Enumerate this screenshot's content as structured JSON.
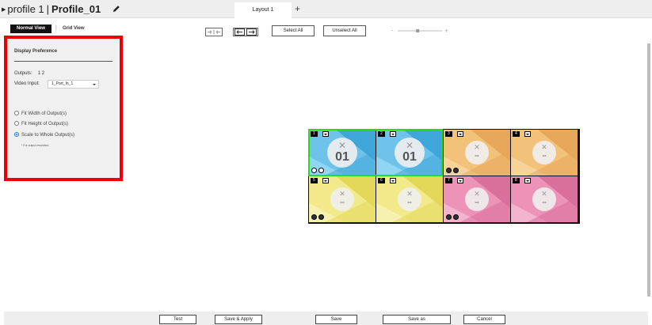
{
  "header": {
    "profile_label": "profile 1",
    "separator": "|",
    "profile_name": "Profile_01",
    "tabs": [
      {
        "label": "Layout 1"
      }
    ],
    "add_tab_label": "+"
  },
  "view_toggle": {
    "normal_label": "Normal View",
    "divider": "|",
    "grid_label": "Grid View",
    "active": "normal"
  },
  "toolbar": {
    "icons": [
      "collapse-arrows-icon",
      "expand-arrows-icon"
    ],
    "select_all_label": "Select All",
    "unselect_all_label": "Unselect All",
    "zoom_minus": "-",
    "zoom_plus": "+",
    "zoom_level": 0.45
  },
  "display_preference": {
    "heading": "Display Preference",
    "outputs_label": "Outputs:",
    "outputs_value": "1 2",
    "video_input_label": "Video Input:",
    "video_input_value": "1_Port_In_1",
    "options": [
      {
        "label": "Fit Width of Output(s)",
        "selected": false
      },
      {
        "label": "Fit Height of Output(s)",
        "selected": false
      },
      {
        "label": "Scale to Whole Output(s)",
        "selected": true
      }
    ],
    "note": "* For output resolution"
  },
  "outputs": [
    {
      "number": "1",
      "badge": "01",
      "theme": "blue"
    },
    {
      "number": "2",
      "badge": "01",
      "theme": "blue"
    },
    {
      "number": "3",
      "badge": "--",
      "theme": "orange"
    },
    {
      "number": "4",
      "badge": "--",
      "theme": "orange"
    },
    {
      "number": "5",
      "badge": "--",
      "theme": "yellow"
    },
    {
      "number": "6",
      "badge": "--",
      "theme": "yellow"
    },
    {
      "number": "7",
      "badge": "--",
      "theme": "pink"
    },
    {
      "number": "8",
      "badge": "--",
      "theme": "pink"
    }
  ],
  "themes": {
    "blue": [
      "#6fc3ea",
      "#3fa6d9",
      "#8fd6f2"
    ],
    "orange": [
      "#f3c27a",
      "#e6a75a",
      "#f7d39a"
    ],
    "yellow": [
      "#f2ea8a",
      "#e3d75a",
      "#f7f1b0"
    ],
    "pink": [
      "#ec93b7",
      "#d9709c",
      "#f3b4cf"
    ]
  },
  "footer": {
    "buttons": [
      {
        "label": "Test"
      },
      {
        "label": "Save & Apply"
      },
      {
        "label": "Save"
      },
      {
        "label": "Save as"
      },
      {
        "label": "Cancel"
      }
    ]
  }
}
